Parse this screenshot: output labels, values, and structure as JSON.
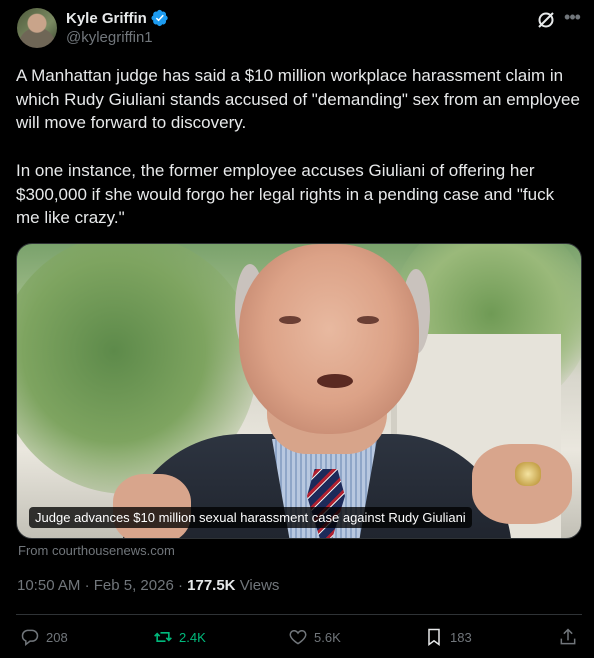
{
  "author": {
    "display_name": "Kyle Griffin",
    "handle": "@kylegriffin1",
    "verified": true,
    "verified_color": "#1d9bf0"
  },
  "tweet": {
    "text": "A Manhattan judge has said a $10 million workplace harassment claim in which Rudy Giuliani stands accused of \"demanding\" sex from an employee will move forward to discovery.\n\nIn one instance, the former employee accuses Giuliani of offering her $300,000 if she would forgo her legal rights in a pending case and \"fuck me like crazy.\""
  },
  "media": {
    "caption": "Judge advances $10 million sexual harassment case against Rudy Giuliani",
    "source": "From courthousenews.com"
  },
  "meta": {
    "time": "10:50 AM",
    "separator": "·",
    "date": "Feb 5, 2026",
    "views_count": "177.5K",
    "views_label": "Views"
  },
  "actions": {
    "replies": "208",
    "reposts": "2.4K",
    "likes": "5.6K",
    "bookmarks": "183",
    "repost_active_color": "#00ba7c"
  },
  "icons": {
    "verified": "verified-badge-icon",
    "grok": "grok-icon",
    "more": "more-icon",
    "reply": "reply-icon",
    "repost": "repost-icon",
    "like": "heart-icon",
    "bookmark": "bookmark-icon",
    "share": "share-icon"
  }
}
